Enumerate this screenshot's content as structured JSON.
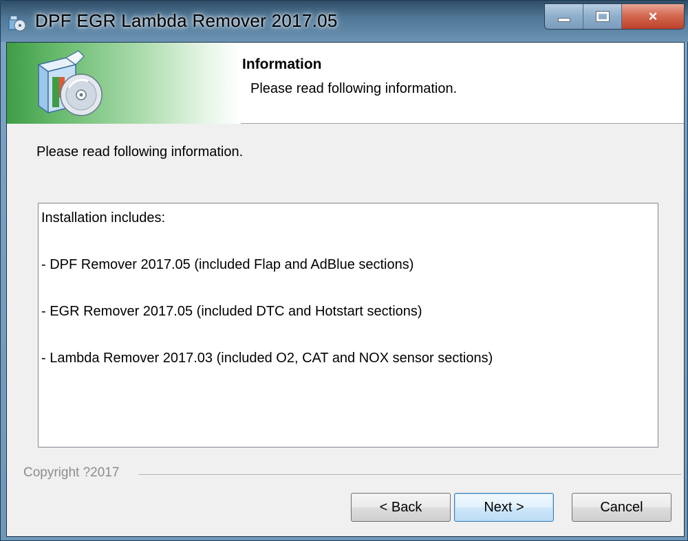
{
  "window": {
    "title": "DPF EGR Lambda Remover 2017.05",
    "close_glyph": "×"
  },
  "header": {
    "title": "Information",
    "subtitle": "Please read following information.",
    "icon": "software-box-cd-icon",
    "gradient_color": "#4caf50"
  },
  "main": {
    "intro": "Please read following information.",
    "info_lines": [
      "Installation includes:",
      " - DPF Remover 2017.05 (included Flap and AdBlue sections)",
      " - EGR Remover 2017.05 (included DTC and Hotstart sections)",
      " - Lambda Remover 2017.03 (included O2, CAT and NOX sensor sections)"
    ]
  },
  "footer": {
    "copyright": "Copyright ?2017",
    "back_label": "< Back",
    "next_label": "Next >",
    "cancel_label": "Cancel"
  },
  "colors": {
    "close_button": "#c7472d",
    "next_button_border": "#3c7fb1",
    "client_background": "#f0f0f0"
  }
}
